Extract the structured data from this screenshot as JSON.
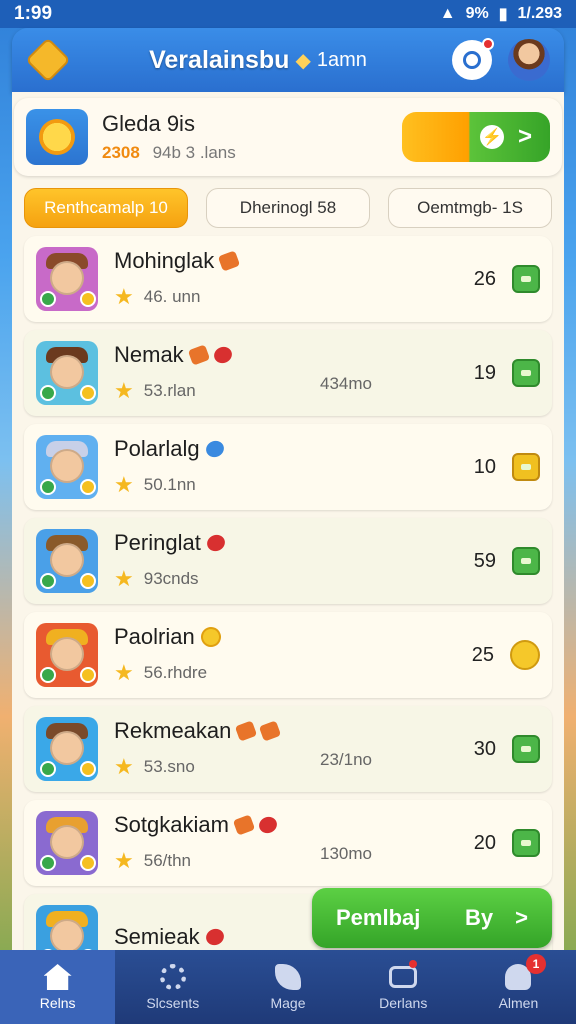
{
  "status_bar": {
    "time": "1:99",
    "right_text": "1/.293",
    "battery": "9%"
  },
  "header": {
    "title": "Veralainsbu",
    "subtitle": "1amn"
  },
  "profile": {
    "name": "Gleda 9is",
    "score": "2308",
    "stats": "94b 3 .lans",
    "claim_icon": "lightning-icon",
    "claim_arrow": ">"
  },
  "tabs": [
    {
      "label": "Renthcamalp  10",
      "active": true
    },
    {
      "label": "Dherinogl 58",
      "active": false
    },
    {
      "label": "Oemtmgb- 1S",
      "active": false
    }
  ],
  "rows": [
    {
      "name": "Mohinglak",
      "sub": "46. unn",
      "extra": "",
      "count": "26",
      "gems": [
        "orange"
      ],
      "reward": "chest",
      "hat": "#8a4a2a",
      "bg": "#c86ac8"
    },
    {
      "name": "Nemak",
      "sub": "53.rlan",
      "extra": "434mo",
      "count": "19",
      "gems": [
        "orange",
        "red"
      ],
      "reward": "chest",
      "hat": "#6b3a1e",
      "bg": "#5cc0e0"
    },
    {
      "name": "Polarlalg",
      "sub": "50.1nn",
      "extra": "",
      "count": "10",
      "gems": [
        "blue"
      ],
      "reward": "chest-gold",
      "hat": "#c8d0e8",
      "bg": "#60b0f0"
    },
    {
      "name": "Peringlat",
      "sub": "93cnds",
      "extra": "",
      "count": "59",
      "gems": [
        "red"
      ],
      "reward": "chest",
      "hat": "#8a5a2a",
      "bg": "#4aa0e8"
    },
    {
      "name": "Paolrian",
      "sub": "56.rhdre",
      "extra": "",
      "count": "25",
      "gems": [
        "gold"
      ],
      "reward": "coin",
      "hat": "#f0b020",
      "bg": "#e85a30"
    },
    {
      "name": "Rekmeakan",
      "sub": "53.sno",
      "extra": "23/1no",
      "count": "30",
      "gems": [
        "orange",
        "orange"
      ],
      "reward": "chest",
      "hat": "#7a4a2a",
      "bg": "#3aa8e8"
    },
    {
      "name": "Sotgkakiam",
      "sub": "56/thn",
      "extra": "130mo",
      "count": "20",
      "gems": [
        "orange",
        "red"
      ],
      "reward": "chest",
      "hat": "#e8a030",
      "bg": "#8a6ad0"
    },
    {
      "name": "Semieak",
      "sub": "",
      "extra": "",
      "count": "",
      "gems": [
        "red"
      ],
      "reward": "",
      "hat": "#f0b020",
      "bg": "#3aa0e0"
    }
  ],
  "play_button": {
    "label": "Pemlbaj",
    "value": "By",
    "arrow": ">"
  },
  "nav": [
    {
      "label": "Relns",
      "icon": "home-icon",
      "active": true,
      "badge": ""
    },
    {
      "label": "Slcsents",
      "icon": "gear-icon",
      "active": false,
      "badge": ""
    },
    {
      "label": "Mage",
      "icon": "leaf-icon",
      "active": false,
      "badge": ""
    },
    {
      "label": "Derlans",
      "icon": "camera-icon",
      "active": false,
      "badge": ""
    },
    {
      "label": "Almen",
      "icon": "person-icon",
      "active": false,
      "badge": "1"
    }
  ]
}
